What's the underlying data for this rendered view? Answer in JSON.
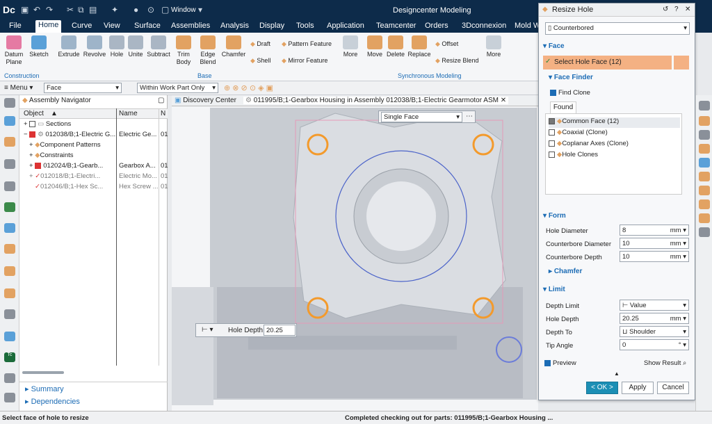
{
  "title_bar": {
    "app_logo": "Dc",
    "window_menu": "Window",
    "app_title": "Designcenter Modeling"
  },
  "menu_tabs": [
    "File",
    "Home",
    "Curve",
    "View",
    "Surface",
    "Assemblies",
    "Analysis",
    "Display",
    "Tools",
    "Application",
    "Teamcenter",
    "Orders",
    "3Dconnexion",
    "Mold W"
  ],
  "ribbon": {
    "construction": {
      "group_label": "Construction",
      "buttons": [
        "Datum\nPlane",
        "Sketch"
      ]
    },
    "base": {
      "group_label": "Base",
      "buttons": [
        "Extrude",
        "Revolve",
        "Hole",
        "Unite",
        "Subtract",
        "Trim\nBody",
        "Edge\nBlend",
        "Chamfer"
      ],
      "small_buttons": [
        "Draft",
        "Shell",
        "Pattern Feature",
        "Mirror Feature"
      ],
      "more": "More"
    },
    "synchronous": {
      "group_label": "Synchronous Modeling",
      "buttons": [
        "Move",
        "Delete",
        "Replace"
      ],
      "small_buttons": [
        "Offset",
        "Resize Blend"
      ],
      "more": "More"
    }
  },
  "selection_bar": {
    "menu_label": "Menu",
    "filter_value": "Face",
    "scope_value": "Within Work Part Only"
  },
  "assembly_navigator": {
    "title": "Assembly Navigator",
    "columns": [
      "Object",
      "Name",
      "N"
    ],
    "rows": [
      {
        "object": "Sections",
        "name": "",
        "n": ""
      },
      {
        "object": "012038/B;1-Electric G...",
        "name": "Electric Ge...",
        "n": "01"
      },
      {
        "object": "Component Patterns",
        "name": "",
        "n": ""
      },
      {
        "object": "Constraints",
        "name": "",
        "n": ""
      },
      {
        "object": "012024/B;1-Gearb...",
        "name": "Gearbox A...",
        "n": "01"
      },
      {
        "object": "012018/B;1-Electri...",
        "name": "Electric Mo...",
        "n": "01"
      },
      {
        "object": "012046/B;1-Hex Sc...",
        "name": "Hex Screw ...",
        "n": "01"
      }
    ],
    "summary": "Summary",
    "dependencies": "Dependencies"
  },
  "viewport": {
    "tabs": [
      "Discovery Center",
      "011995/B;1-Gearbox Housing in Assembly 012038/B;1-Electric Gearmotor ASM"
    ],
    "selection_dropdown": "Single Face",
    "hole_depth_label": "Hole Depth",
    "hole_depth_value": "20.25"
  },
  "resize_hole": {
    "title": "Resize Hole",
    "type": "Counterbored",
    "face_section": "Face",
    "select_hole_face": "Select Hole Face (12)",
    "face_finder": "Face Finder",
    "find_clone": "Find Clone",
    "found_tab": "Found",
    "found_items": [
      {
        "label": "Common Face (12)",
        "checked": true
      },
      {
        "label": "Coaxial (Clone)",
        "checked": false
      },
      {
        "label": "Coplanar Axes (Clone)",
        "checked": false
      },
      {
        "label": "Hole Clones",
        "checked": false
      }
    ],
    "form_section": "Form",
    "form_fields": [
      {
        "label": "Hole Diameter",
        "value": "8",
        "unit": "mm"
      },
      {
        "label": "Counterbore Diameter",
        "value": "10",
        "unit": "mm"
      },
      {
        "label": "Counterbore Depth",
        "value": "10",
        "unit": "mm"
      }
    ],
    "chamfer": "Chamfer",
    "limit_section": "Limit",
    "depth_limit_label": "Depth Limit",
    "depth_limit_value": "Value",
    "hole_depth_label": "Hole Depth",
    "hole_depth_value": "20.25",
    "hole_depth_unit": "mm",
    "depth_to_label": "Depth To",
    "depth_to_value": "Shoulder",
    "tip_angle_label": "Tip Angle",
    "tip_angle_value": "0",
    "tip_angle_unit": "°",
    "preview": "Preview",
    "show_result": "Show Result",
    "ok": "< OK >",
    "apply": "Apply",
    "cancel": "Cancel"
  },
  "status_bar": {
    "left": "Select face of hole to resize",
    "center": "Completed checking out for parts: 011995/B;1-Gearbox Housing ..."
  },
  "colors": {
    "title_bg": "#0d2b4a",
    "accent": "#1c6cb5",
    "highlight": "#f4b183",
    "ok_button": "#1c8fb5",
    "hole_orange": "#f39a2c"
  }
}
